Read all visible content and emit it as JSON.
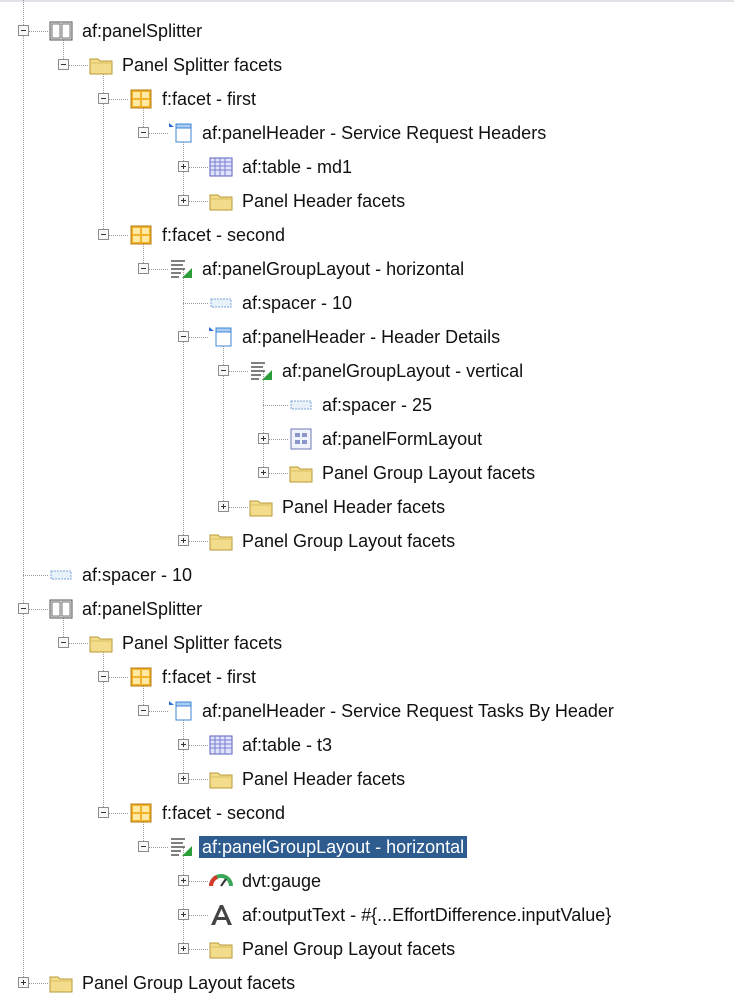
{
  "tree": {
    "selected_index": 24,
    "nodes": [
      {
        "depth": 0,
        "toggle": "minus",
        "icon": "panel-splitter-icon",
        "label": "af:panelSplitter"
      },
      {
        "depth": 1,
        "toggle": "minus",
        "icon": "folder-icon",
        "label": "Panel Splitter facets"
      },
      {
        "depth": 2,
        "toggle": "minus",
        "icon": "facet-icon",
        "label": "f:facet - first"
      },
      {
        "depth": 3,
        "toggle": "minus",
        "icon": "panel-header-icon",
        "label": "af:panelHeader - Service Request Headers"
      },
      {
        "depth": 4,
        "toggle": "plus",
        "icon": "table-icon",
        "label": "af:table - md1"
      },
      {
        "depth": 4,
        "toggle": "plus",
        "icon": "folder-icon",
        "label": "Panel Header facets"
      },
      {
        "depth": 2,
        "toggle": "minus",
        "icon": "facet-icon",
        "label": "f:facet - second"
      },
      {
        "depth": 3,
        "toggle": "minus",
        "icon": "panel-group-layout-icon",
        "label": "af:panelGroupLayout - horizontal"
      },
      {
        "depth": 4,
        "toggle": "none",
        "icon": "spacer-icon",
        "label": "af:spacer - 10"
      },
      {
        "depth": 4,
        "toggle": "minus",
        "icon": "panel-header-icon",
        "label": "af:panelHeader - Header Details"
      },
      {
        "depth": 5,
        "toggle": "minus",
        "icon": "panel-group-layout-icon",
        "label": "af:panelGroupLayout - vertical"
      },
      {
        "depth": 6,
        "toggle": "none",
        "icon": "spacer-icon",
        "label": "af:spacer - 25"
      },
      {
        "depth": 6,
        "toggle": "plus",
        "icon": "panel-form-layout-icon",
        "label": "af:panelFormLayout"
      },
      {
        "depth": 6,
        "toggle": "plus",
        "icon": "folder-icon",
        "label": "Panel Group Layout facets"
      },
      {
        "depth": 5,
        "toggle": "plus",
        "icon": "folder-icon",
        "label": "Panel Header facets"
      },
      {
        "depth": 4,
        "toggle": "plus",
        "icon": "folder-icon",
        "label": "Panel Group Layout facets"
      },
      {
        "depth": 0,
        "toggle": "none",
        "icon": "spacer-icon",
        "label": "af:spacer - 10"
      },
      {
        "depth": 0,
        "toggle": "minus",
        "icon": "panel-splitter-icon",
        "label": "af:panelSplitter"
      },
      {
        "depth": 1,
        "toggle": "minus",
        "icon": "folder-icon",
        "label": "Panel Splitter facets"
      },
      {
        "depth": 2,
        "toggle": "minus",
        "icon": "facet-icon",
        "label": "f:facet - first"
      },
      {
        "depth": 3,
        "toggle": "minus",
        "icon": "panel-header-icon",
        "label": "af:panelHeader - Service Request Tasks By Header"
      },
      {
        "depth": 4,
        "toggle": "plus",
        "icon": "table-icon",
        "label": "af:table - t3"
      },
      {
        "depth": 4,
        "toggle": "plus",
        "icon": "folder-icon",
        "label": "Panel Header facets"
      },
      {
        "depth": 2,
        "toggle": "minus",
        "icon": "facet-icon",
        "label": "f:facet - second"
      },
      {
        "depth": 3,
        "toggle": "minus",
        "icon": "panel-group-layout-icon",
        "label": "af:panelGroupLayout - horizontal"
      },
      {
        "depth": 4,
        "toggle": "plus",
        "icon": "gauge-icon",
        "label": "dvt:gauge"
      },
      {
        "depth": 4,
        "toggle": "plus",
        "icon": "output-text-icon",
        "label": "af:outputText - #{...EffortDifference.inputValue}"
      },
      {
        "depth": 4,
        "toggle": "plus",
        "icon": "folder-icon",
        "label": "Panel Group Layout facets"
      },
      {
        "depth": 0,
        "toggle": "plus",
        "icon": "folder-icon",
        "label": "Panel Group Layout facets"
      }
    ]
  },
  "colors": {
    "selection_bg": "#2f5c8f",
    "folder": "#f3dc8b",
    "guide_line": "#9a9a9a"
  }
}
